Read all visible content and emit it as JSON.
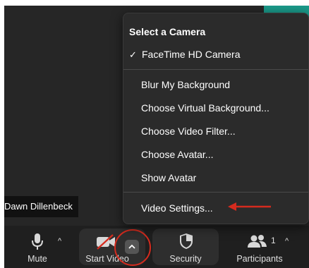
{
  "participant": {
    "name": "Dawn Dillenbeck"
  },
  "menu": {
    "header": "Select a Camera",
    "camera_check": "✓",
    "camera_item": "FaceTime HD Camera",
    "items": [
      "Blur My Background",
      "Choose Virtual Background...",
      "Choose Video Filter...",
      "Choose Avatar...",
      "Show Avatar"
    ],
    "settings_item": "Video Settings..."
  },
  "toolbar": {
    "mute_label": "Mute",
    "start_video_label": "Start Video",
    "security_label": "Security",
    "participants_label": "Participants",
    "participants_count": "1",
    "caret": "^"
  },
  "colors": {
    "annotation": "#d52b1e",
    "menu_bg": "#2b2b2b",
    "toolbar_bg": "#1f1f1f",
    "teal": "#1a9a8a"
  }
}
